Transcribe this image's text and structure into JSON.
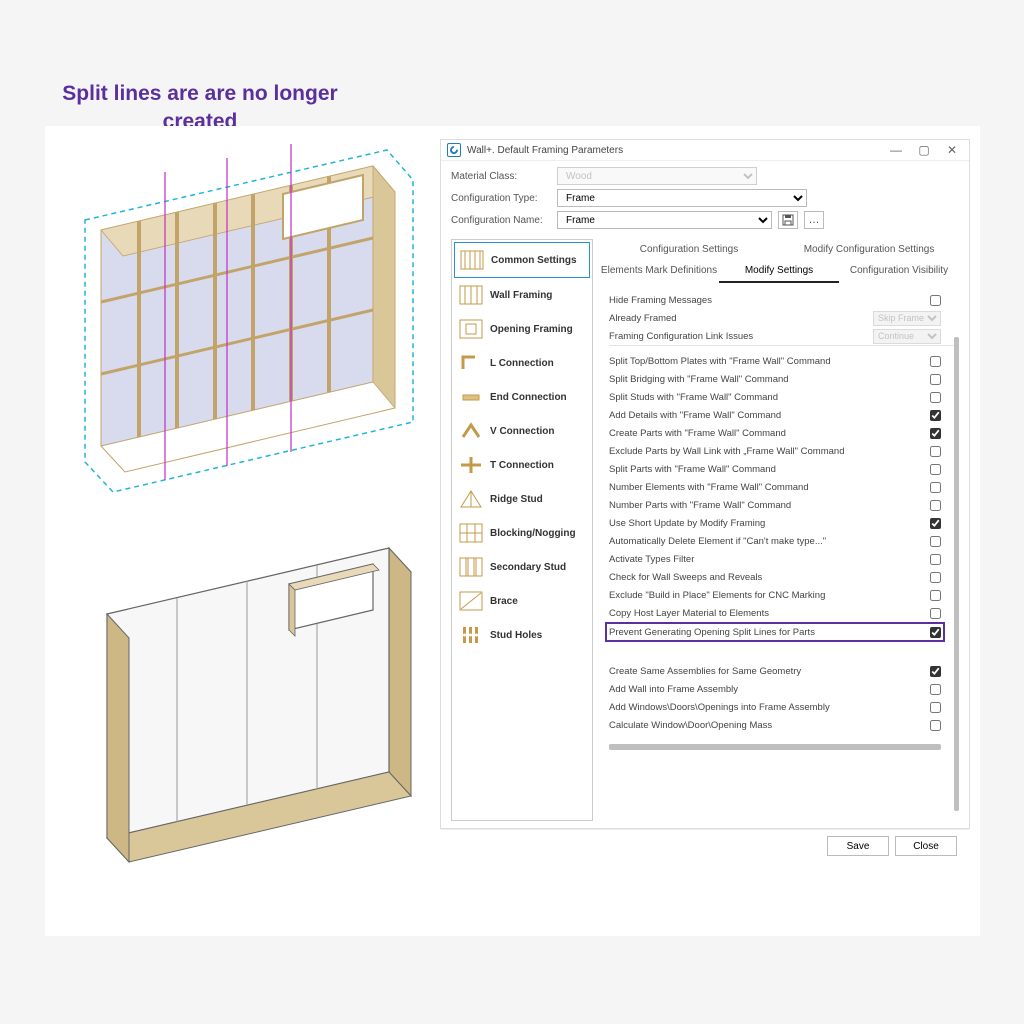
{
  "annotation": "Split lines are are no longer created",
  "dialog": {
    "title": "Wall+. Default Framing Parameters",
    "form": {
      "material_class_label": "Material Class:",
      "material_class_value": "Wood",
      "config_type_label": "Configuration Type:",
      "config_type_value": "Frame",
      "config_name_label": "Configuration Name:",
      "config_name_value": "Frame"
    },
    "categories": [
      "Common Settings",
      "Wall Framing",
      "Opening Framing",
      "L Connection",
      "End Connection",
      "V Connection",
      "T Connection",
      "Ridge Stud",
      "Blocking/Nogging",
      "Secondary Stud",
      "Brace",
      "Stud Holes"
    ],
    "tabs_top": [
      "Configuration Settings",
      "Modify Configuration Settings"
    ],
    "tabs_sub": [
      "Elements Mark Definitions",
      "Modify Settings",
      "Configuration Visibility"
    ],
    "options_group1": [
      {
        "label": "Hide Framing Messages",
        "type": "check",
        "checked": false
      },
      {
        "label": "Already Framed",
        "type": "select",
        "value": "Skip Frame"
      },
      {
        "label": "Framing Configuration Link Issues",
        "type": "select",
        "value": "Continue"
      }
    ],
    "options_group2": [
      {
        "label": "Split Top/Bottom Plates with \"Frame Wall\" Command",
        "checked": false
      },
      {
        "label": "Split Bridging with \"Frame Wall\" Command",
        "checked": false
      },
      {
        "label": "Split Studs with \"Frame Wall\" Command",
        "checked": false
      },
      {
        "label": "Add Details with \"Frame Wall\" Command",
        "checked": true
      },
      {
        "label": "Create Parts with \"Frame Wall\" Command",
        "checked": true
      },
      {
        "label": "Exclude Parts by Wall Link with „Frame Wall\" Command",
        "checked": false
      },
      {
        "label": "Split Parts with \"Frame Wall\" Command",
        "checked": false
      },
      {
        "label": "Number Elements with \"Frame Wall\" Command",
        "checked": false
      },
      {
        "label": "Number Parts with \"Frame Wall\" Command",
        "checked": false
      },
      {
        "label": "Use Short Update by Modify Framing",
        "checked": true
      },
      {
        "label": "Automatically Delete Element if \"Can't make type...\"",
        "checked": false
      },
      {
        "label": "Activate Types Filter",
        "checked": false
      },
      {
        "label": "Check for Wall Sweeps and Reveals",
        "checked": false
      },
      {
        "label": "Exclude \"Build in Place\" Elements for CNC Marking",
        "checked": false
      },
      {
        "label": "Copy Host Layer Material to Elements",
        "checked": false
      },
      {
        "label": "Prevent Generating Opening Split Lines for Parts",
        "checked": true,
        "highlight": true
      }
    ],
    "options_group3": [
      {
        "label": "Create Same Assemblies for Same Geometry",
        "checked": true
      },
      {
        "label": "Add Wall into Frame Assembly",
        "checked": false
      },
      {
        "label": "Add Windows\\Doors\\Openings into Frame Assembly",
        "checked": false
      },
      {
        "label": "Calculate Window\\Door\\Opening Mass",
        "checked": false
      }
    ],
    "buttons": {
      "save": "Save",
      "close": "Close"
    }
  }
}
